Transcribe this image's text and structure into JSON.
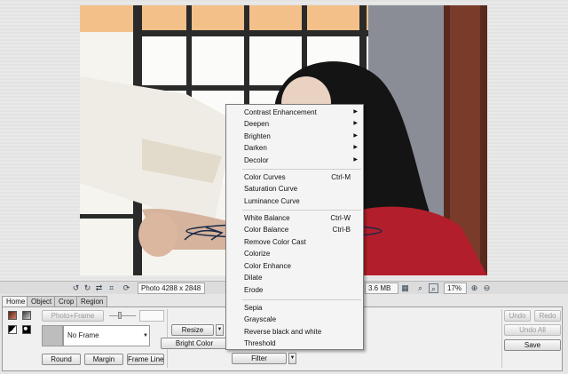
{
  "status_bar": {
    "photo_info": "Photo 4288 x 2848",
    "file_size": "3.6 MB",
    "zoom": "17%"
  },
  "tabs": [
    {
      "label": "Home",
      "active": true
    },
    {
      "label": "Object",
      "active": false
    },
    {
      "label": "Crop",
      "active": false
    },
    {
      "label": "Region",
      "active": false
    }
  ],
  "ribbon": {
    "photo_frame_label": "Photo+Frame",
    "frame_select_value": "No Frame",
    "round_label": "Round",
    "margin_label": "Margin",
    "frame_line_label": "Frame Line",
    "resize_label": "Resize",
    "bright_color_label": "Bright Color",
    "filter_label": "Filter",
    "undo_label": "Undo",
    "redo_label": "Redo",
    "undo_all_label": "Undo All",
    "save_label": "Save"
  },
  "menu": {
    "group1": [
      {
        "label": "Contrast Enhancement",
        "submenu": true
      },
      {
        "label": "Deepen",
        "submenu": true
      },
      {
        "label": "Brighten",
        "submenu": true
      },
      {
        "label": "Darken",
        "submenu": true
      },
      {
        "label": "Decolor",
        "submenu": true
      }
    ],
    "group2": [
      {
        "label": "Color Curves",
        "shortcut": "Ctrl-M"
      },
      {
        "label": "Saturation Curve",
        "shortcut": ""
      },
      {
        "label": "Luminance Curve",
        "shortcut": ""
      }
    ],
    "group3": [
      {
        "label": "White Balance",
        "shortcut": "Ctrl-W"
      },
      {
        "label": "Color Balance",
        "shortcut": "Ctrl-B"
      },
      {
        "label": "Remove Color Cast",
        "shortcut": ""
      },
      {
        "label": "Colorize",
        "shortcut": ""
      },
      {
        "label": "Color Enhance",
        "shortcut": ""
      },
      {
        "label": "Dilate",
        "shortcut": ""
      },
      {
        "label": "Erode",
        "shortcut": ""
      }
    ],
    "group4": [
      {
        "label": "Sepia"
      },
      {
        "label": "Grayscale"
      },
      {
        "label": "Reverse black and white"
      },
      {
        "label": "Threshold"
      }
    ]
  },
  "colors": {
    "accent_annotation": "#1a2a4a",
    "arrow_yellow": "#f2c200"
  }
}
